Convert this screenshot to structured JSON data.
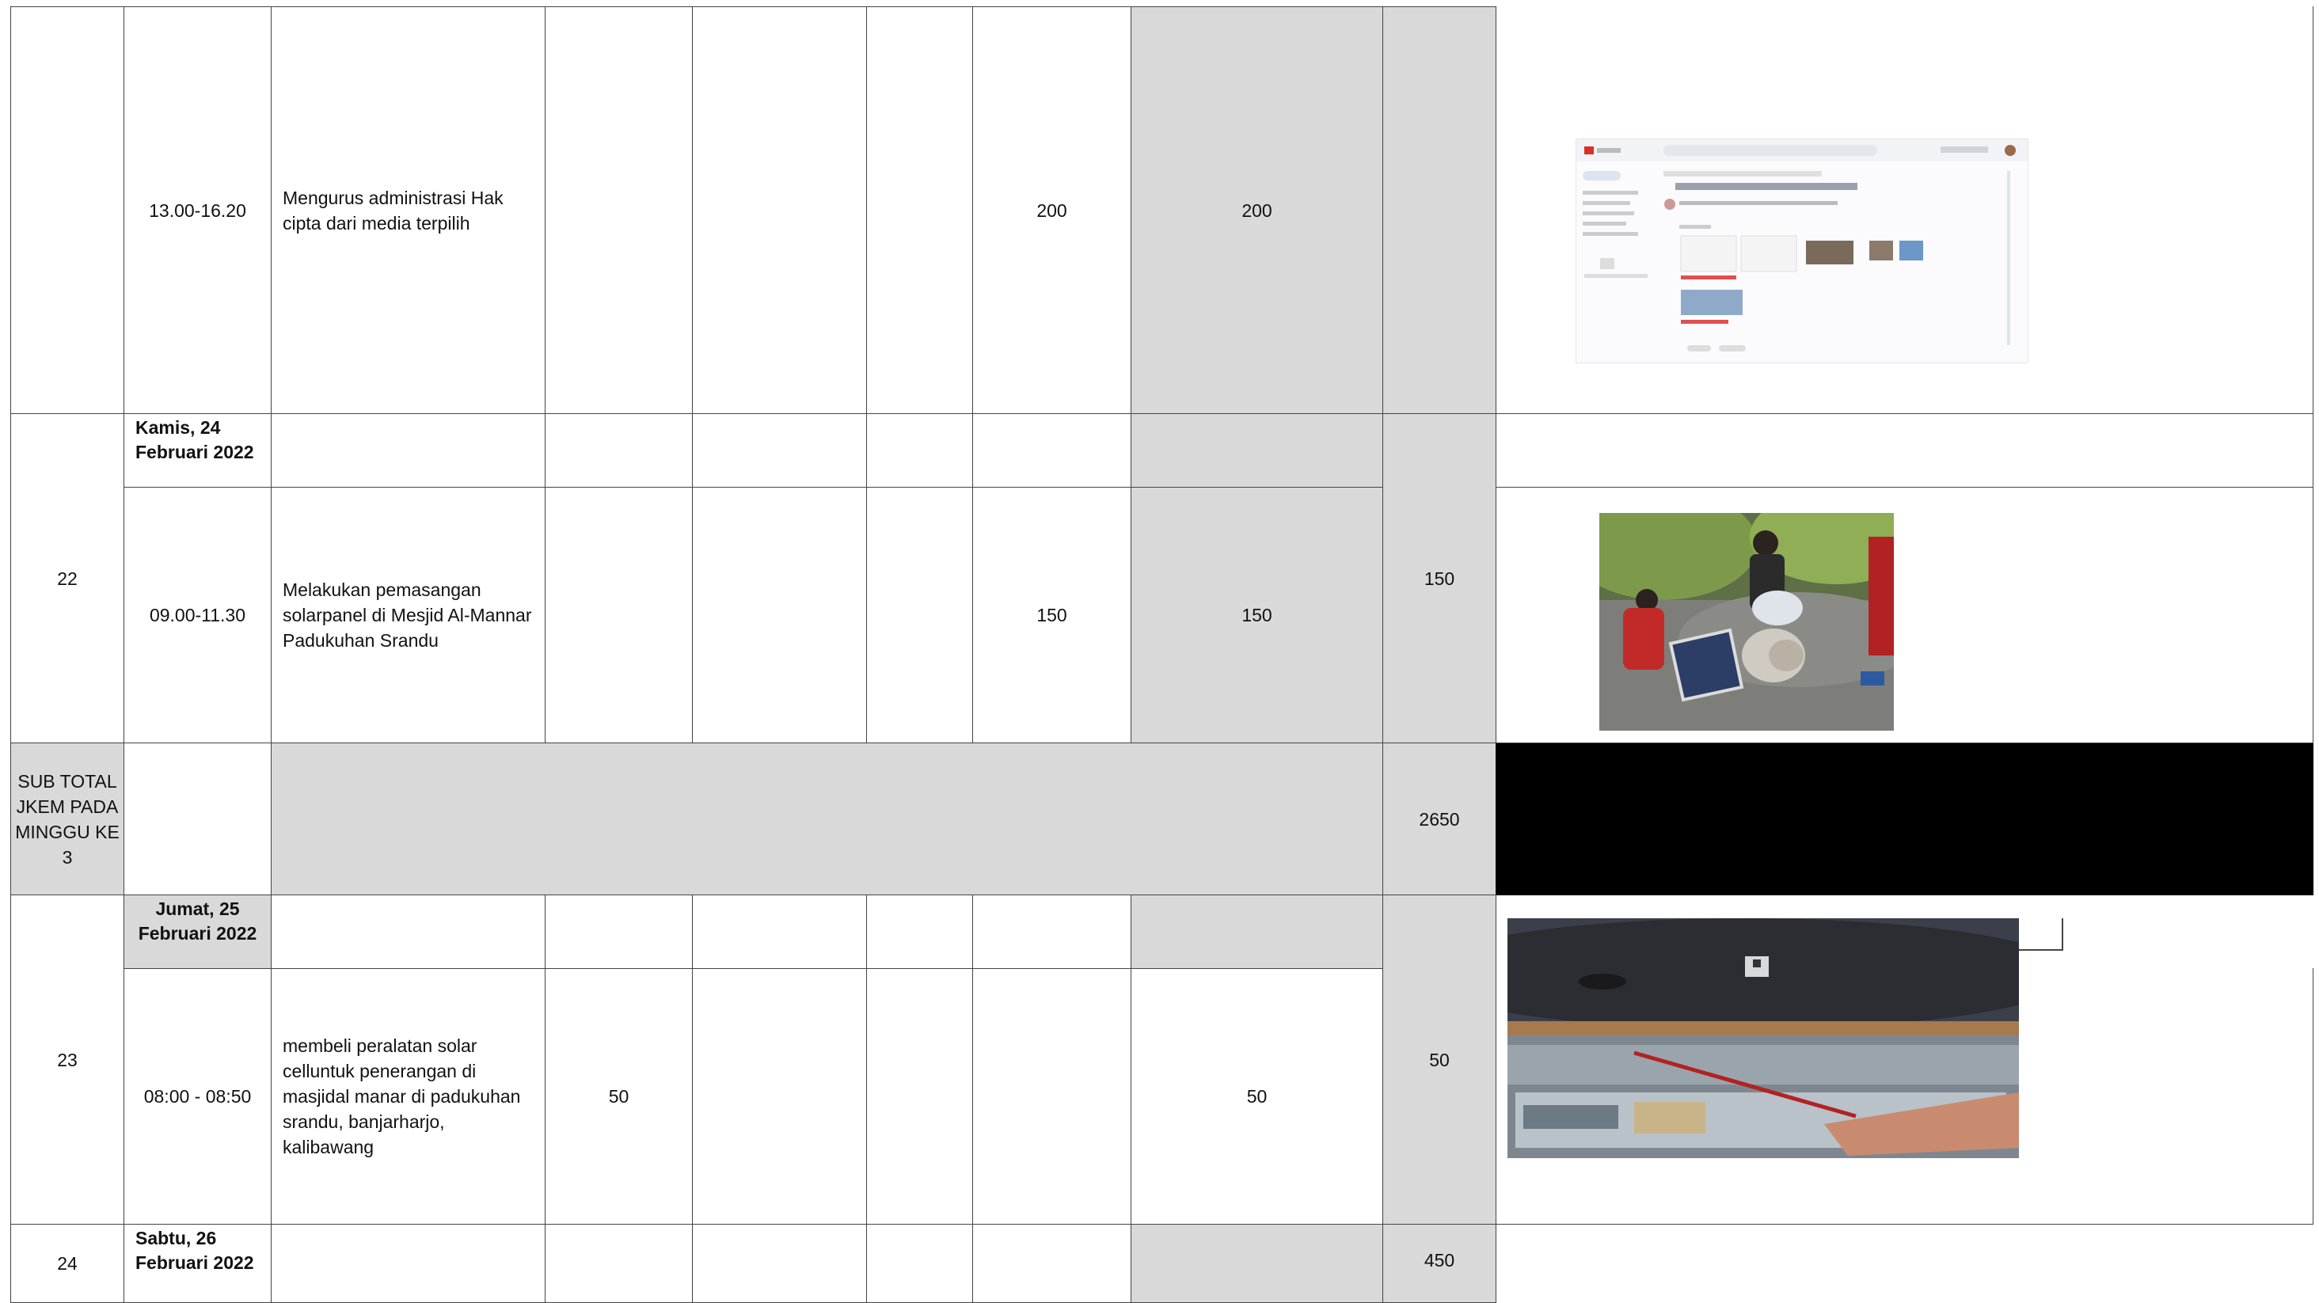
{
  "rows": {
    "r21": {
      "time": "13.00-16.20",
      "activity": "Mengurus administrasi Hak cipta dari media terpilih",
      "col_h": "200",
      "col_i": "200"
    },
    "r22": {
      "no": "22",
      "date": "Kamis, 24 Februari 2022",
      "time": "09.00-11.30",
      "activity": "Melakukan pemasangan solarpanel di Mesjid Al-Mannar Padukuhan Srandu",
      "col_h": "150",
      "col_i": "150",
      "total": "150"
    },
    "subtotal": {
      "label": "SUB TOTAL JKEM PADA MINGGU KE 3",
      "total": "2650"
    },
    "r23": {
      "no": "23",
      "date": "Jumat, 25 Februari 2022",
      "time": "08:00 - 08:50",
      "activity": "membeli peralatan solar celluntuk penerangan di masjidal manar di padukuhan srandu, banjarharjo, kalibawang",
      "col_d": "50",
      "col_i": "50",
      "total": "50"
    },
    "r24": {
      "no": "24",
      "date": "Sabtu,  26 Februari 2022",
      "total": "450"
    }
  },
  "photos": [
    {
      "name": "gmail-screenshot-photo",
      "icon": "email-icon"
    },
    {
      "name": "solar-panel-installation-photo",
      "icon": "photo-icon"
    },
    {
      "name": "solar-equipment-purchase-photo",
      "icon": "photo-icon"
    }
  ],
  "colors": {
    "header_grey": "#d9d9d9",
    "border": "#444444",
    "redacted": "#000000"
  }
}
